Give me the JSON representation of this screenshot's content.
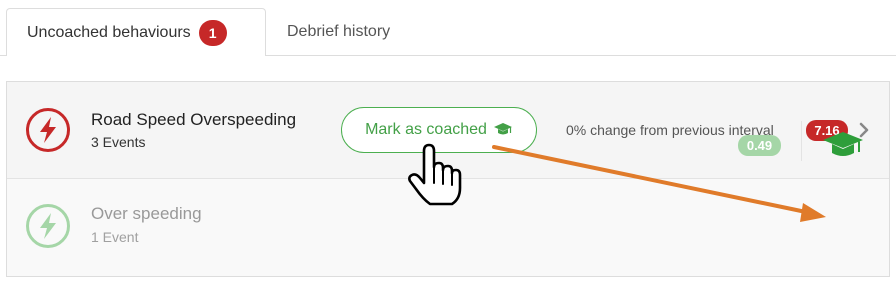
{
  "tabs": {
    "uncoached_label": "Uncoached behaviours",
    "uncoached_count": "1",
    "debrief_label": "Debrief history"
  },
  "behaviours": [
    {
      "title": "Road Speed Overspeeding",
      "events": "3 Events",
      "coach_label": "Mark as coached",
      "change_text": "0% change from previous interval",
      "score": "7.16",
      "score_color": "#c62828",
      "icon": "lightning-bolt-icon"
    },
    {
      "title": "Over speeding",
      "events": "1 Event",
      "score": "0.49",
      "score_color": "#a5d6a7",
      "icon": "lightning-bolt-icon",
      "coached_icon": "graduation-cap-icon"
    }
  ],
  "colors": {
    "accent_green": "#43a047",
    "alert_red": "#c62828",
    "annotation_orange": "#e07b2a"
  }
}
